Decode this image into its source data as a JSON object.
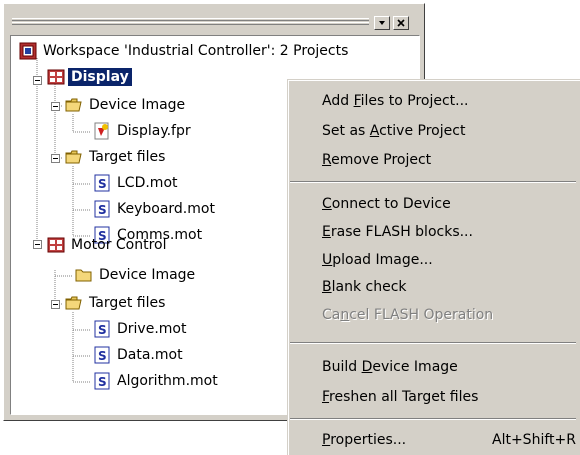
{
  "workspace": {
    "root_label": "Workspace 'Industrial Controller': 2 Projects",
    "projects": [
      {
        "label": "Display",
        "selected": true,
        "device_image": {
          "label": "Device Image",
          "files": [
            "Display.fpr"
          ]
        },
        "target_files": {
          "label": "Target files",
          "files": [
            "LCD.mot",
            "Keyboard.mot",
            "Comms.mot"
          ]
        }
      },
      {
        "label": "Motor Control",
        "selected": false,
        "device_image": {
          "label": "Device Image",
          "files": []
        },
        "target_files": {
          "label": "Target files",
          "files": [
            "Drive.mot",
            "Data.mot",
            "Algorithm.mot"
          ]
        }
      }
    ]
  },
  "menu": {
    "items": [
      {
        "pre": "Add ",
        "acc": "F",
        "post": "iles to Project...",
        "disabled": false
      },
      {
        "pre": "Set as ",
        "acc": "A",
        "post": "ctive Project",
        "disabled": false
      },
      {
        "pre": "",
        "acc": "R",
        "post": "emove Project",
        "disabled": false
      },
      {
        "pre": "",
        "acc": "C",
        "post": "onnect to Device",
        "disabled": false
      },
      {
        "pre": "",
        "acc": "E",
        "post": "rase FLASH blocks...",
        "disabled": false
      },
      {
        "pre": "",
        "acc": "U",
        "post": "pload Image...",
        "disabled": false
      },
      {
        "pre": "",
        "acc": "B",
        "post": "lank check",
        "disabled": false
      },
      {
        "pre": "Ca",
        "acc": "n",
        "post": "cel FLASH Operation",
        "disabled": true
      },
      {
        "pre": "Build ",
        "acc": "D",
        "post": "evice Image",
        "disabled": false
      },
      {
        "pre": "",
        "acc": "F",
        "post": "reshen all Target files",
        "disabled": false
      },
      {
        "pre": "",
        "acc": "P",
        "post": "roperties...",
        "disabled": false,
        "shortcut": "Alt+Shift+R"
      }
    ]
  },
  "colors": {
    "selection": "#0a246a",
    "face": "#d4d0c8",
    "disabled_text": "#808080"
  }
}
